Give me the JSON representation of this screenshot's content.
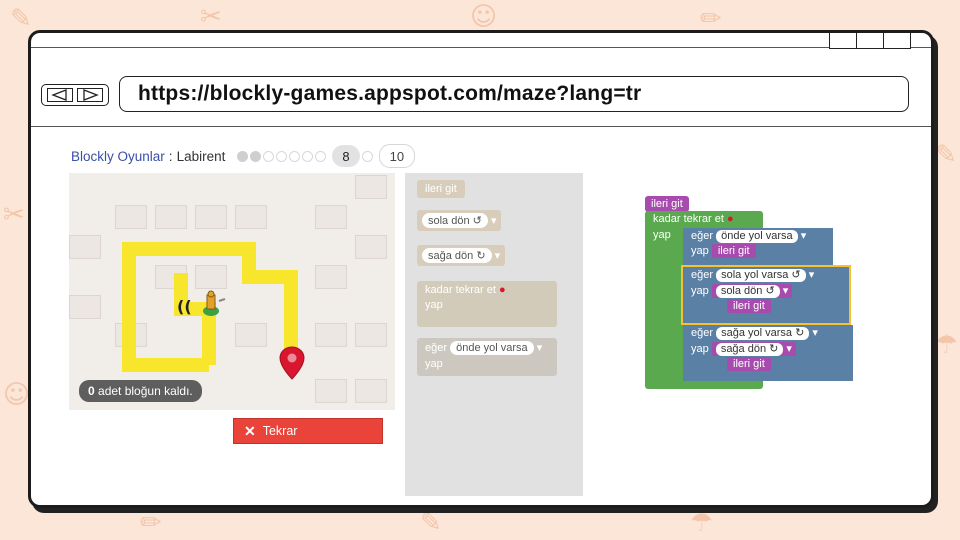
{
  "browser": {
    "url": "https://blockly-games.appspot.com/maze?lang=tr"
  },
  "header": {
    "app_title": "Blockly Oyunlar",
    "separator": ":",
    "game_name": "Labirent",
    "current_level": "8",
    "max_level": "10",
    "levels_completed": 2
  },
  "maze": {
    "blocks_left_count": "0",
    "blocks_left_text": " adet bloğun kaldı.",
    "colors": {
      "path": "#f7e62c",
      "marker": "#d8172f"
    }
  },
  "reset_button": {
    "icon": "close-icon",
    "label": "Tekrar"
  },
  "toolbox": {
    "move_forward": "ileri git",
    "turn_left": "sola dön ↺",
    "turn_right": "sağa dön ↻",
    "repeat_until": "kadar tekrar et",
    "repeat_do": "yap",
    "if_label": "eğer",
    "if_path_ahead": "önde yol varsa",
    "if_do": "yap"
  },
  "workspace": {
    "move_forward": "ileri git",
    "repeat_until": "kadar tekrar et",
    "repeat_do": "yap",
    "if1": {
      "label": "eğer",
      "condition": "önde yol varsa",
      "do": "yap",
      "action": "ileri git"
    },
    "if2": {
      "label": "eğer",
      "condition": "sola yol varsa ↺",
      "do": "yap",
      "action1": "sola dön ↺",
      "action2": "ileri git"
    },
    "if3": {
      "label": "eğer",
      "condition": "sağa yol varsa ↻",
      "do": "yap",
      "action1": "sağa dön ↻",
      "action2": "ileri git"
    },
    "colors": {
      "motion": "#a74cae",
      "loop": "#5aa94f",
      "logic": "#5b80a5",
      "highlight": "#f6c22f"
    }
  }
}
